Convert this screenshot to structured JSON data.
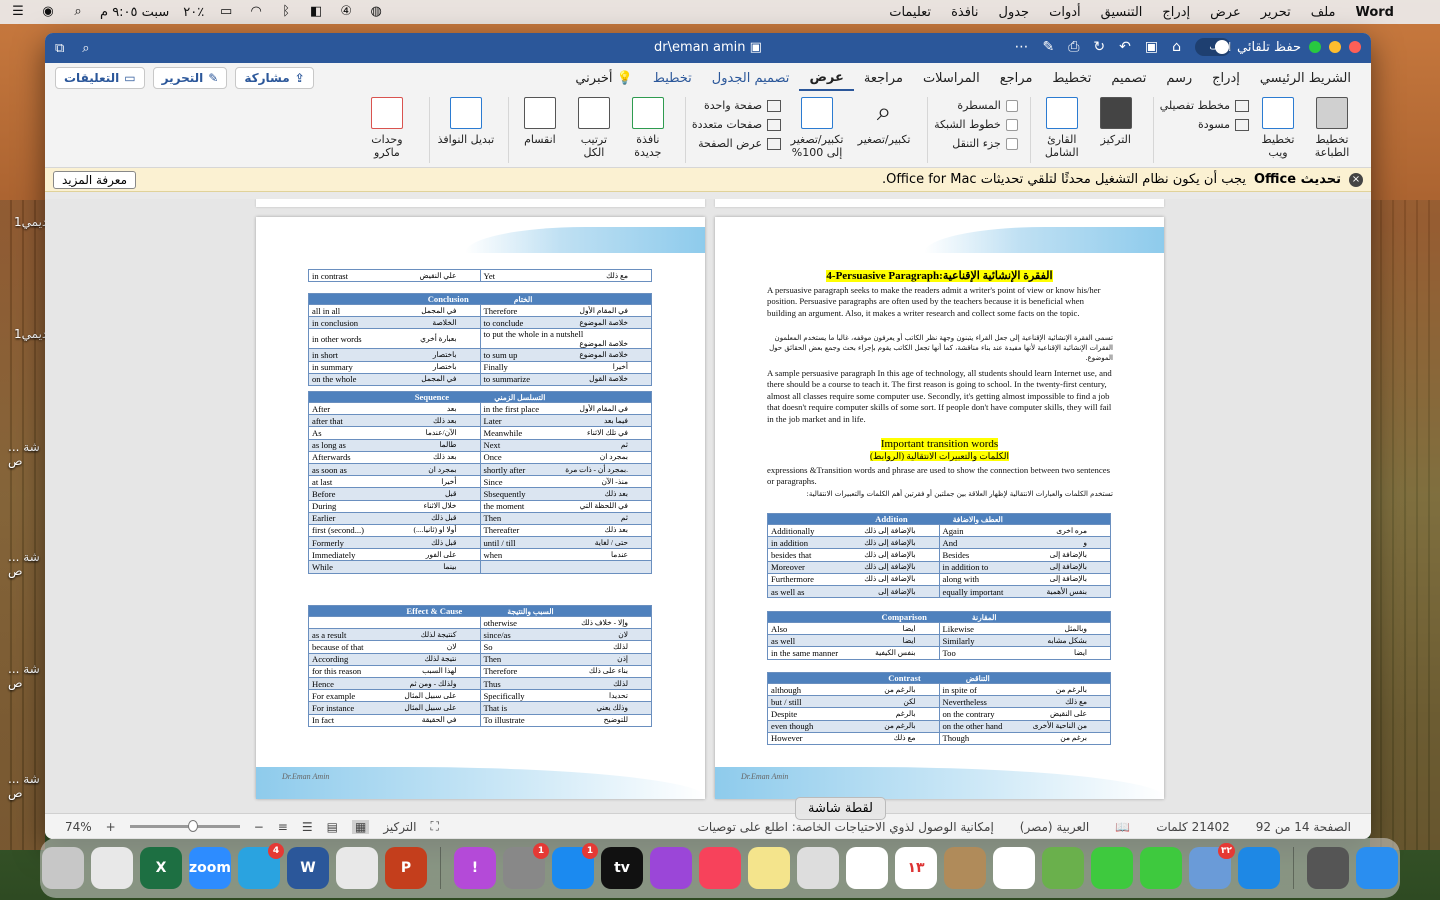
{
  "menubar": {
    "app_name": "Word",
    "menus": [
      "ملف",
      "تحرير",
      "عرض",
      "إدراج",
      "التنسيق",
      "أدوات",
      "جدول",
      "نافذة",
      "تعليمات"
    ],
    "clock": "سبت ٩:٠٥ م",
    "battery": "٢٠٪"
  },
  "window": {
    "title": "dr\\eman amin",
    "autosave_label": "حفظ تلقائي",
    "autosave_state": "إيقاف"
  },
  "tabs": [
    "الشريط الرئيسي",
    "إدراج",
    "رسم",
    "تصميم",
    "تخطيط",
    "مراجع",
    "المراسلات",
    "مراجعة",
    "عرض",
    "تصميم الجدول",
    "تخطيط",
    "أخبرني"
  ],
  "active_tab": "عرض",
  "header_actions": {
    "share": "مشاركة",
    "edit": "التحرير",
    "comments": "التعليقات"
  },
  "ribbon": {
    "print_layout": "تخطيط الطباعة",
    "web_layout": "تخطيط ويب",
    "outline": "مخطط تفصيلي",
    "draft": "مسودة",
    "focus": "التركيز",
    "immersive_reader": "القارئ الشامل",
    "ruler": "المسطرة",
    "gridlines": "خطوط الشبكة",
    "nav_pane": "جزء التنقل",
    "zoom": "تكبير/تصغير",
    "zoom100": "تكبير/تصغير إلى 100%",
    "one_page": "صفحة واحدة",
    "multiple_pages": "صفحات متعددة",
    "page_width": "عرض الصفحة",
    "new_window": "نافذة جديدة",
    "arrange_all": "ترتيب الكل",
    "split": "انقسام",
    "switch_windows": "تبديل النوافذ",
    "macros": "وحدات ماكرو"
  },
  "infobar": {
    "title": "تحديث Office",
    "message": "يجب أن يكون نظام التشغيل محدثًا لتلقي تحديثات Office for Mac.",
    "learn_more": "معرفة المزيد"
  },
  "left_page": {
    "top_row": {
      "en1": "in contrast",
      "ar1": "علي النقيض",
      "en2": "Yet",
      "ar2": "مع ذلك"
    },
    "conclusion": {
      "header_en": "Conclusion",
      "header_ar": "الختام",
      "rows": [
        [
          "all in all",
          "في المجمل",
          "Therefore",
          "في المقام الأول"
        ],
        [
          "in conclusion",
          "الخلاصة",
          "to conclude",
          "خلاصة الموضوع"
        ],
        [
          "in other words",
          "بعبارة أخري",
          "to put the whole in a nutshell",
          "خلاصة الموضوع"
        ],
        [
          "in short",
          "باختصار",
          "to sum up",
          "خلاصة الموضوع"
        ],
        [
          "in summary",
          "باختصار",
          "Finally",
          "أخيرا"
        ],
        [
          "on the whole",
          "في المجمل",
          "to summarize",
          "خلاصة القول"
        ]
      ]
    },
    "sequence": {
      "header_en": "Sequence",
      "header_ar": "التسلسل الزمني",
      "rows": [
        [
          "After",
          "بعد",
          "in the first place",
          "في المقام الأول"
        ],
        [
          "after that",
          "بعد ذلك",
          "Later",
          "فيما بعد"
        ],
        [
          "As",
          "الآن/عندما",
          "Meanwhile",
          "في تلك الاثناء"
        ],
        [
          "as long as",
          "طالما",
          "Next",
          "ثم"
        ],
        [
          "Afterwards",
          "بعد ذلك",
          "Once",
          "بمجرد ان"
        ],
        [
          "as soon as",
          "بمجرد ان",
          "shortly after",
          "بمجرد أن - ذات مرة."
        ],
        [
          "at last",
          "أخيرا",
          "Since",
          "منذ- الآن"
        ],
        [
          "Before",
          "قبل",
          "Sbsequently",
          "بعد ذلك"
        ],
        [
          "During",
          "خلال الاثناء",
          "the moment",
          "في اللحظة التي"
        ],
        [
          "Earlier",
          "قبل ذلك",
          "Then",
          "ثم"
        ],
        [
          "first (second...)",
          "أولا او (ثانيا....)",
          "Thereafter",
          "بعد ذلك"
        ],
        [
          "Formerly",
          "قبل ذلك",
          "until / till",
          "حتى / لغاية"
        ],
        [
          "Immediately",
          "على الفور",
          "when",
          "عندما"
        ],
        [
          "While",
          "بينما",
          "",
          ""
        ]
      ]
    },
    "effect": {
      "header_en": "Effect & Cause",
      "header_ar": "السبب والنتيجة",
      "rows": [
        [
          "",
          "",
          "otherwise",
          "وإلا - خلاف ذلك"
        ],
        [
          "as a result",
          "كنتيجة لذلك",
          "since/as",
          "لان"
        ],
        [
          "because of that",
          "لان",
          "So",
          "لذلك"
        ],
        [
          "According",
          "نتيجة لذلك",
          "Then",
          "إذن"
        ],
        [
          "for this reason",
          "لهذا السبب",
          "Therefore",
          "بناء على ذلك"
        ],
        [
          "Hence",
          "ولذلك - ومن ثم",
          "Thus",
          "لذلك"
        ],
        [
          "For example",
          "على سبيل المثال",
          "Specifically",
          "تحديدا"
        ],
        [
          "For instance",
          "على سبيل المثال",
          "That is",
          "وذلك يعني"
        ],
        [
          "In fact",
          "في الحقيقة",
          "To illustrate",
          "للتوضيح"
        ]
      ]
    },
    "footer": "Dr.Eman Amin"
  },
  "right_page": {
    "heading": "4-Persuasive Paragraph:الفقرة الإنشائية الإقناعية",
    "p1": "A persuasive paragraph seeks to make the readers admit a writer's point of view or know his/her position. Persuasive paragraphs are often used by the teachers because it is beneficial when building an argument. Also, it makes a writer research and collect some facts on the topic.",
    "p1_ar": "تسمى الفقرة الإنشائية الإقناعية إلى جعل القراء يتبنون وجهة نظر الكاتب أو يعرفون موقفه، غالبا ما يستخدم المعلمون الفقرات الإنشائية الإقناعية لأنها مفيدة عند بناء مناقشة، كما أنها تجعل الكاتب يقوم بإجراء بحث وجمع بعض الحقائق حول الموضوع.",
    "p2": "A sample persuasive paragraph In this age of technology, all students should learn Internet use, and there should be a course to teach it. The first reason is going to school. In the twenty-first century, almost all classes require some computer use. Secondly, it's getting almost impossible to find a job that doesn't require computer skills of some sort. If people don't have computer skills, they will fail in the job market and in life.",
    "sub1": "Important transition words",
    "sub2": "الكلمات والتعبيرات الانتقالية (الروابط)",
    "p3": "expressions &Transition words and phrase are used to show the connection between two sentences or paragraphs.",
    "p3_ar": "تستخدم الكلمات والعبارات الانتقالية لإظهار العلاقة بين جملتين أو فقرتين أهم الكلمات والتعبيرات الانتقالية:",
    "addition": {
      "header_en": "Addition",
      "header_ar": "العطف والاضافة",
      "rows": [
        [
          "Additionally",
          "بالإضافة إلى ذلك",
          "Again",
          "مره اخرى"
        ],
        [
          "in addition",
          "بالإضافة إلى ذلك",
          "And",
          "و"
        ],
        [
          "besides that",
          "بالإضافة إلى ذلك",
          "Besides",
          "بالإضافة إلى"
        ],
        [
          "Moreover",
          "بالإضافة إلى ذلك",
          "in addition to",
          "بالإضافة إلى"
        ],
        [
          "Furthermore",
          "بالإضافة إلى ذلك",
          "along with",
          "بالإضافة إلى"
        ],
        [
          "as well as",
          "بالإضافة إلى",
          "equally important",
          "بنفس الأهمية"
        ]
      ]
    },
    "comparison": {
      "header_en": "Comparison",
      "header_ar": "المقارنة",
      "rows": [
        [
          "Also",
          "ايضا",
          "Likewise",
          "وبالمثل"
        ],
        [
          "as well",
          "ايضا",
          "Similarly",
          "بشكل مشابه"
        ],
        [
          "in the same manner",
          "بنفس الكيفية",
          "Too",
          "ايضا"
        ]
      ]
    },
    "contrast": {
      "header_en": "Contrast",
      "header_ar": "التناقض",
      "rows": [
        [
          "although",
          "بالرغم من",
          "in spite of",
          "بالرغم من"
        ],
        [
          "but / still",
          "لكن",
          "Nevertheless",
          "مع ذلك"
        ],
        [
          "Despite",
          "بالرغم",
          "on the contrary",
          "على النقيض"
        ],
        [
          "even though",
          "بالرغم من",
          "on the other hand",
          "من الناحية الأخرى"
        ],
        [
          "However",
          "مع ذلك",
          "Though",
          "برغم من"
        ]
      ]
    },
    "footer": "Dr.Eman Amin"
  },
  "statusbar": {
    "page": "الصفحة 14 من 92",
    "words": "21402 كلمات",
    "language": "العربية (مصر)",
    "accessibility": "إمكانية الوصول لذوي الاحتياجات الخاصة: اطلع على توصيات",
    "focus": "التركيز",
    "zoom": "74%"
  },
  "tooltip": "لقطة شاشة",
  "desktop_labels": [
    "ديمي1",
    "ديمي1",
    "شة ... ص",
    "شة ... ص",
    "شة ... ص",
    "شة ... ص"
  ],
  "dock": [
    {
      "name": "finder",
      "color": "#c7c7c7"
    },
    {
      "name": "chrome",
      "color": "#e8e8e8"
    },
    {
      "name": "excel",
      "color": "#1d6f42",
      "label": "X"
    },
    {
      "name": "zoom",
      "color": "#2d8cff",
      "label": "zoom"
    },
    {
      "name": "telegram",
      "color": "#2aa3e0",
      "badge": "4"
    },
    {
      "name": "word",
      "color": "#2b579a",
      "label": "W"
    },
    {
      "name": "chrome2",
      "color": "#e8e8e8"
    },
    {
      "name": "powerpoint",
      "color": "#c43e1c",
      "label": "P"
    },
    {
      "name": "feedback",
      "color": "#b44ad8",
      "label": "!"
    },
    {
      "name": "settings",
      "color": "#888888",
      "badge": "1"
    },
    {
      "name": "appstore",
      "color": "#1b8af0",
      "badge": "1"
    },
    {
      "name": "tv",
      "color": "#111111",
      "label": "tv"
    },
    {
      "name": "podcasts",
      "color": "#9b46d8"
    },
    {
      "name": "music",
      "color": "#f7425b"
    },
    {
      "name": "notes",
      "color": "#f4e48c"
    },
    {
      "name": "screenshot",
      "color": "#dddddd"
    },
    {
      "name": "reminders",
      "color": "#ffffff"
    },
    {
      "name": "calendar",
      "color": "#ffffff",
      "label": "١٣"
    },
    {
      "name": "contacts",
      "color": "#b08b5a"
    },
    {
      "name": "photos",
      "color": "#ffffff"
    },
    {
      "name": "maps",
      "color": "#6ab04c"
    },
    {
      "name": "messages",
      "color": "#3ec93e"
    },
    {
      "name": "facetime",
      "color": "#3ec93e"
    },
    {
      "name": "preview",
      "color": "#6a9bd8",
      "badge": "٣٢"
    },
    {
      "name": "safari",
      "color": "#1e88e5"
    },
    {
      "name": "launchpad",
      "color": "#555555"
    },
    {
      "name": "finder2",
      "color": "#2a8ef0"
    }
  ]
}
